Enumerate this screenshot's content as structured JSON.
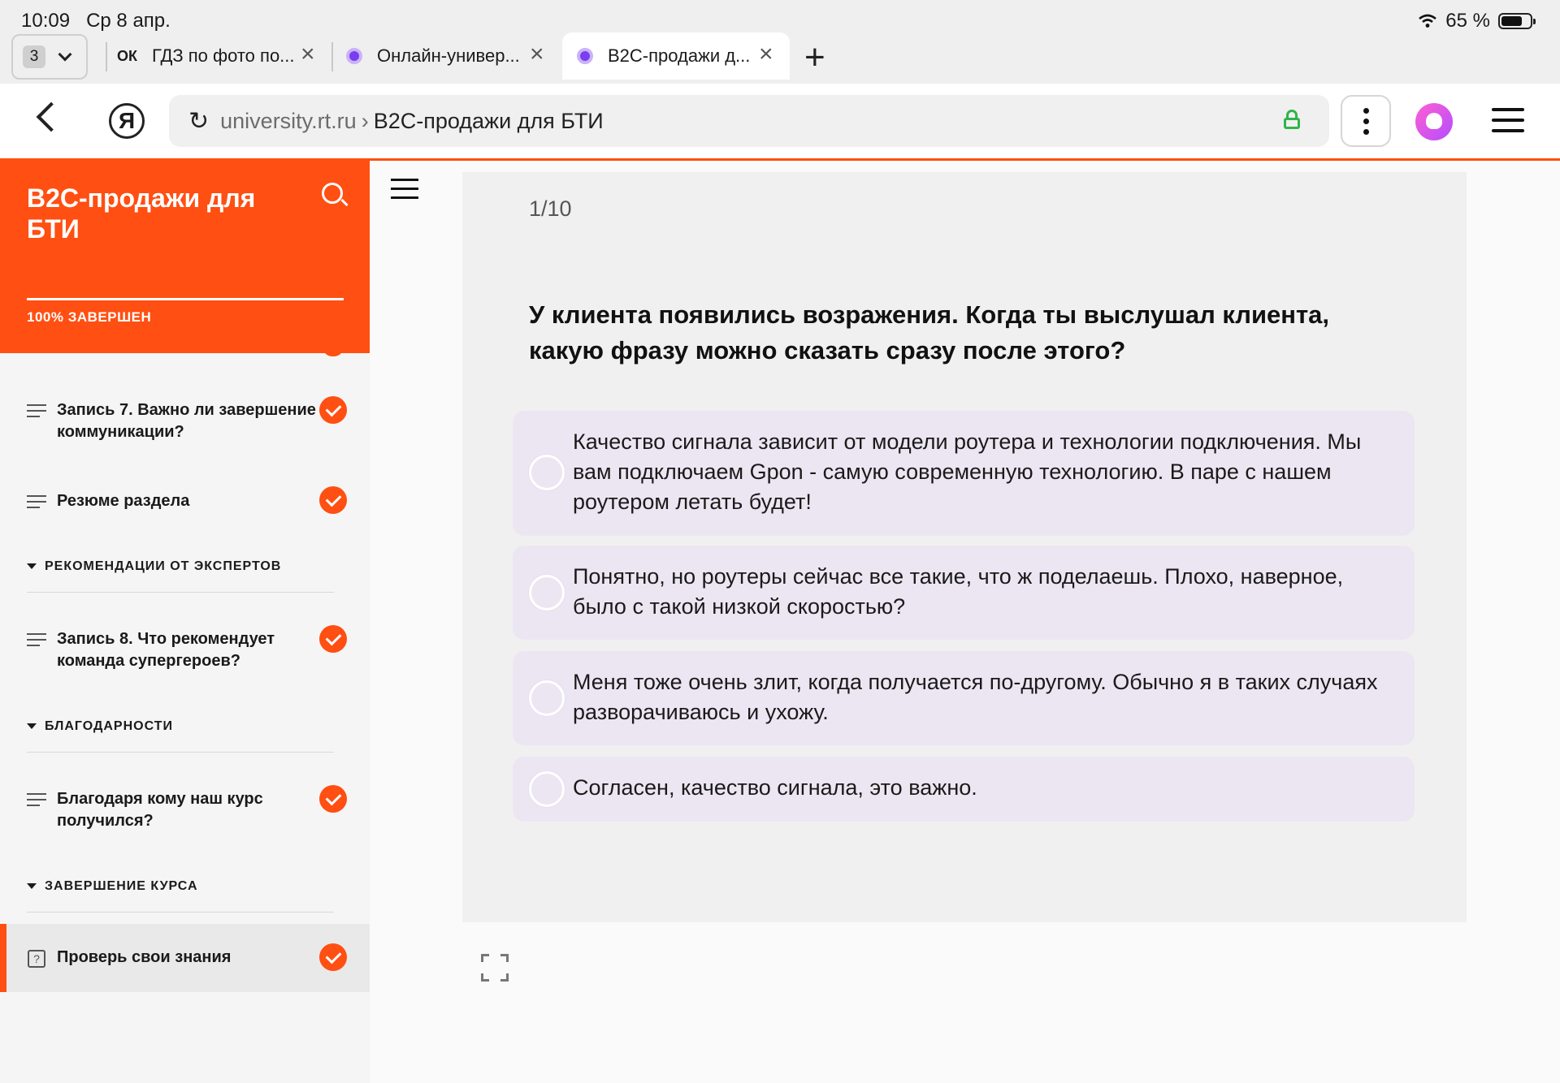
{
  "status": {
    "time": "10:09",
    "date": "Ср 8 апр.",
    "battery": "65 %"
  },
  "tabs": {
    "count": "3",
    "items": [
      {
        "favicon": "ОК",
        "label": "ГДЗ по фото по..."
      },
      {
        "label": "Онлайн-универ..."
      },
      {
        "label": "B2C-продажи д..."
      }
    ]
  },
  "address": {
    "host": "university.rt.ru",
    "separator": "›",
    "title": "B2C-продажи для БТИ",
    "logo": "Я"
  },
  "sidebar": {
    "course_title": "B2C-продажи для БТИ",
    "progress_label": "100% ЗАВЕРШЕН",
    "progress_value": 1.0,
    "lessons": [
      {
        "label": "Запись 7. Важно ли завершение коммуникации?",
        "done": true
      },
      {
        "label": "Резюме раздела",
        "done": true
      }
    ],
    "sections": [
      {
        "label": "РЕКОМЕНДАЦИИ ОТ ЭКСПЕРТОВ",
        "lesson": "Запись 8. Что рекомендует команда супергероев?"
      },
      {
        "label": "БЛАГОДАРНОСТИ",
        "lesson": "Благодаря кому наш курс получился?"
      },
      {
        "label": "ЗАВЕРШЕНИЕ КУРСА",
        "lesson": "Проверь свои знания"
      }
    ],
    "quiz_icon": "?"
  },
  "quiz": {
    "counter": "1/10",
    "question": "У клиента появились возражения. Когда ты выслушал клиента, какую фразу можно сказать сразу после этого?",
    "options": [
      "Качество сигнала зависит от модели роутера и технологии подключения. Мы вам подключаем Gpon - самую современную технологию. В паре с нашем роутером летать будет!",
      "Понятно, но роутеры сейчас все такие, что ж поделаешь. Плохо, наверное, было с такой низкой скоростью?",
      "Меня тоже очень злит, когда получается по-другому. Обычно я в таких случаях разворачиваюсь и ухожу.",
      "Согласен, качество сигнала, это важно."
    ]
  },
  "colors": {
    "accent": "#ff4f12",
    "option_bg": "#ece6f2",
    "secure_lock": "#2fb54a"
  },
  "icons": [
    "wifi-icon",
    "battery-icon",
    "chevron-down-icon",
    "close-icon",
    "plus-icon",
    "back-icon",
    "reload-icon",
    "lock-icon",
    "kebab-icon",
    "alice-icon",
    "menu-icon",
    "search-icon",
    "lesson-lines-icon",
    "check-icon",
    "expand-icon",
    "quiz-icon"
  ]
}
